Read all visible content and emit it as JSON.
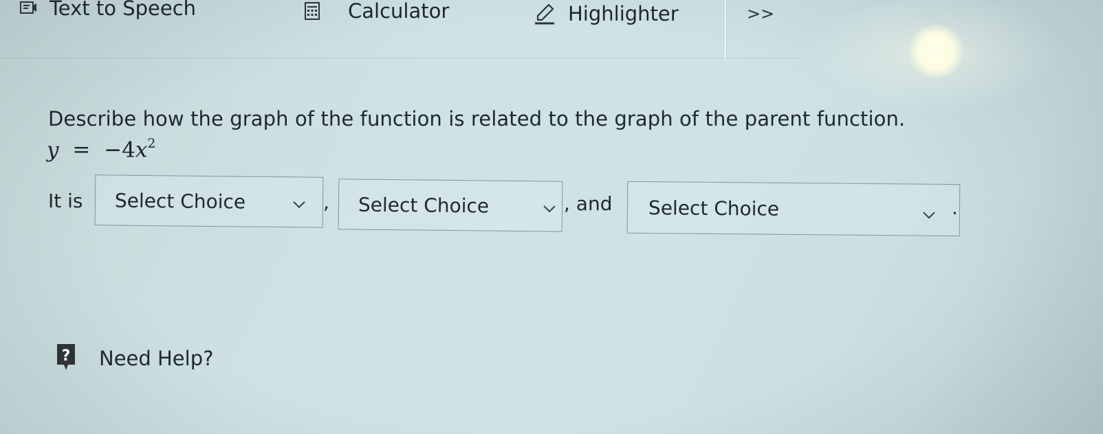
{
  "toolbar": {
    "text_to_speech": {
      "label": "Text to Speech",
      "icon": "text-to-speech-icon"
    },
    "calculator": {
      "label": "Calculator",
      "icon": "calculator-icon"
    },
    "highlighter": {
      "label": "Highlighter",
      "icon": "highlighter-icon"
    },
    "more": {
      "label": ">>"
    }
  },
  "question": {
    "prompt": "Describe how the graph of the function is related to the graph of the parent function.",
    "equation": {
      "lhs": "y",
      "equals": "=",
      "coefficient": "−4",
      "variable": "x",
      "exponent": "2"
    },
    "sentence": {
      "lead": "It is",
      "separator_1": ",",
      "separator_2": ", and",
      "end": "."
    },
    "selects": [
      {
        "value": "Select Choice"
      },
      {
        "value": "Select Choice"
      },
      {
        "value": "Select Choice"
      }
    ]
  },
  "help": {
    "label": "Need Help?",
    "icon_glyph": "?",
    "icon": "help-question-icon"
  },
  "colors": {
    "background": "#cfe2e4",
    "text": "#1e282d",
    "help_icon": "#2f3336",
    "border": "#46555c"
  }
}
